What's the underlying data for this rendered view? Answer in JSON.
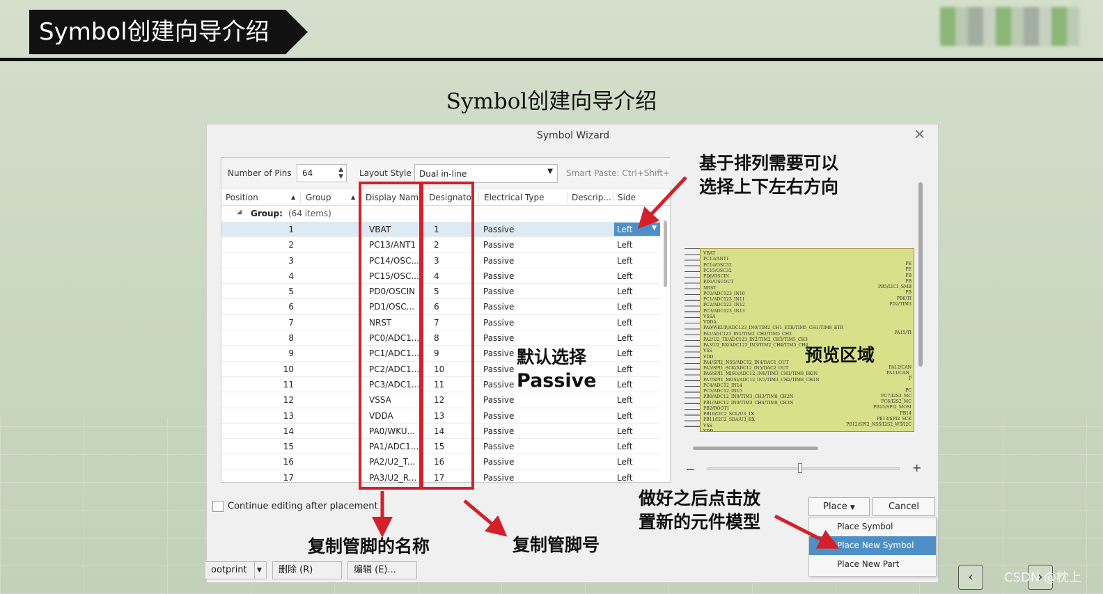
{
  "slide": {
    "banner_title": "Symbol创建向导介绍",
    "subtitle": "Symbol创建向导介绍",
    "watermark": "CSDN @枕上"
  },
  "dialog": {
    "title": "Symbol Wizard",
    "close_glyph": "✕",
    "toolbar": {
      "pins_label": "Number of Pins",
      "pins_value": "64",
      "layout_label": "Layout Style",
      "layout_value": "Dual in-line",
      "smart_paste": "Smart Paste: Ctrl+Shift+V"
    },
    "columns": {
      "position": "Position",
      "group": "Group",
      "display_name": "Display Name",
      "designator": "Designator",
      "electrical_type": "Electrical Type",
      "description": "Descrip...",
      "side": "Side"
    },
    "group_row": {
      "label": "Group:",
      "count": "(64 items)"
    },
    "rows": [
      {
        "pos": "1",
        "name": "VBAT",
        "des": "1",
        "type": "Passive",
        "side": "Left"
      },
      {
        "pos": "2",
        "name": "PC13/ANT1",
        "des": "2",
        "type": "Passive",
        "side": "Left"
      },
      {
        "pos": "3",
        "name": "PC14/OSC...",
        "des": "3",
        "type": "Passive",
        "side": "Left"
      },
      {
        "pos": "4",
        "name": "PC15/OSC...",
        "des": "4",
        "type": "Passive",
        "side": "Left"
      },
      {
        "pos": "5",
        "name": "PD0/OSCIN",
        "des": "5",
        "type": "Passive",
        "side": "Left"
      },
      {
        "pos": "6",
        "name": "PD1/OSC...",
        "des": "6",
        "type": "Passive",
        "side": "Left"
      },
      {
        "pos": "7",
        "name": "NRST",
        "des": "7",
        "type": "Passive",
        "side": "Left"
      },
      {
        "pos": "8",
        "name": "PC0/ADC1...",
        "des": "8",
        "type": "Passive",
        "side": "Left"
      },
      {
        "pos": "9",
        "name": "PC1/ADC1...",
        "des": "9",
        "type": "Passive",
        "side": "Left"
      },
      {
        "pos": "10",
        "name": "PC2/ADC1...",
        "des": "10",
        "type": "Passive",
        "side": "Left"
      },
      {
        "pos": "11",
        "name": "PC3/ADC1...",
        "des": "11",
        "type": "Passive",
        "side": "Left"
      },
      {
        "pos": "12",
        "name": "VSSA",
        "des": "12",
        "type": "Passive",
        "side": "Left"
      },
      {
        "pos": "13",
        "name": "VDDA",
        "des": "13",
        "type": "Passive",
        "side": "Left"
      },
      {
        "pos": "14",
        "name": "PA0/WKU...",
        "des": "14",
        "type": "Passive",
        "side": "Left"
      },
      {
        "pos": "15",
        "name": "PA1/ADC1...",
        "des": "15",
        "type": "Passive",
        "side": "Left"
      },
      {
        "pos": "16",
        "name": "PA2/U2_T...",
        "des": "16",
        "type": "Passive",
        "side": "Left"
      },
      {
        "pos": "17",
        "name": "PA3/U2_R...",
        "des": "17",
        "type": "Passive",
        "side": "Left"
      }
    ],
    "preview": {
      "left_pins": [
        "VBAT",
        "PC13/ANT1",
        "PC14/OSC32",
        "PC15/OSC32",
        "PD0/OSCIN",
        "PD1/OSCOUT",
        "NRST",
        "PC0/ADC123_IN10",
        "PC1/ADC123_IN11",
        "PC2/ADC123_IN12",
        "PC3/ADC123_IN13",
        "VSSA",
        "VDDA",
        "PA0/WKUP/ADC123_IN0/TIM2_CH1_ETR/TIM5_CH1/TIM8_ETR",
        "PA1/ADC123_IN1/TIM2_CH2/TIM5_CH2",
        "PA2/U2_TX/ADC123_IN2/TIM2_CH3/TIM5_CH3",
        "PA3/U2_RX/ADC123_IN3/TIM2_CH4/TIM5_CH4",
        "VSS",
        "VDD",
        "PA4/SPI1_NSS/ADC12_IN4/DAC1_OUT",
        "PA5/SPI1_SCK/ADC12_IN5/DAC2_OUT",
        "PA6/SPI1_MISO/ADC12_IN6/TIM3_CH1/TIM8_BKIN",
        "PA7/SPI1_MOSI/ADC12_IN7/TIM3_CH2/TIM8_CH1N",
        "PC4/ADC12_IN14",
        "PC5/ADC12_IN15",
        "PB0/ADC12_IN8/TIM3_CH3/TIM8_CH2N",
        "PB1/ADC12_IN9/TIM3_CH4/TIM8_CH3N",
        "PB2/BOOT1",
        "PB10/I2C2_SCL/U3_TX",
        "PB11/I2C2_SDA/U3_RX",
        "VSS",
        "VDD"
      ],
      "right_pins": [
        "PE",
        "PE",
        "PB",
        "PB",
        "PB5/I2C1_SMB",
        "PB",
        "PB6/TI",
        "PD2/TIM3",
        "",
        "",
        "",
        "",
        "PA15/TI",
        "",
        "",
        "",
        "",
        "",
        "PA12/CAN",
        "PA11/CAN_",
        "P",
        "",
        "PC",
        "PC7/I2S3_MC",
        "PC6/I2S2_MC",
        "PB15/SPI2_MOSI",
        "PB14",
        "PB13/SPI2_SCK",
        "PB12/SPI2_NSS/I2S2_WS/I2C"
      ],
      "zoom_minus": "−",
      "zoom_plus": "+",
      "zoom_level": 0.48
    },
    "continue_label": "Continue editing after placement",
    "place_button": "Place",
    "cancel_button": "Cancel",
    "place_menu": [
      "Place Symbol",
      "Place New Symbol",
      "Place New Part"
    ],
    "bottom_strip": {
      "footprint": "ootprint",
      "delete": "删除 (R)",
      "edit": "编辑 (E)..."
    }
  },
  "annotations": {
    "direction": [
      "基于排列需要可以",
      "选择上下左右方向"
    ],
    "passive": [
      "默认选择",
      "Passive"
    ],
    "preview_area": "预览区域",
    "place_new": [
      "做好之后点击放",
      "置新的元件模型"
    ],
    "copy_names": "复制管脚的名称",
    "copy_numbers": "复制管脚号"
  },
  "colors": {
    "annotation_red": "#d3202a",
    "selection_blue": "#4f8fc7",
    "symbol_fill": "#d8e08a"
  },
  "nav": {
    "prev": "‹",
    "next": "›"
  }
}
